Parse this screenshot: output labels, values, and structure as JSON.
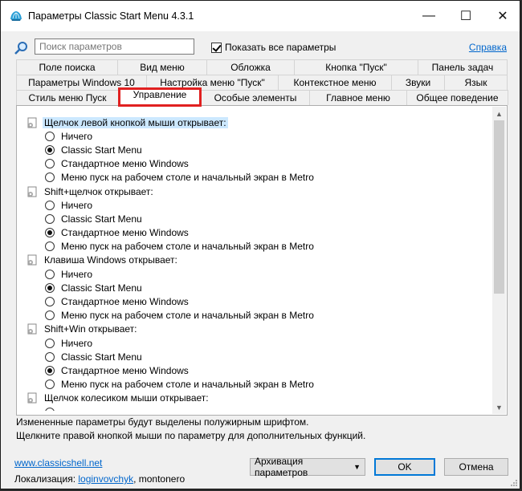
{
  "window": {
    "title": "Параметры Classic Start Menu 4.3.1",
    "minimize": "—",
    "maximize": "☐",
    "close": "✕"
  },
  "toolbar": {
    "search_placeholder": "Поиск параметров",
    "show_all_label": "Показать все параметры",
    "show_all_checked": true,
    "help_link": "Справка"
  },
  "tabs": {
    "row1": [
      "Поле поиска",
      "Вид меню",
      "Обложка",
      "Кнопка \"Пуск\"",
      "Панель задач"
    ],
    "row2": [
      "Параметры Windows 10",
      "Настройка меню \"Пуск\"",
      "Контекстное меню",
      "Звуки",
      "Язык"
    ],
    "row3": [
      "Стиль меню Пуск",
      "Управление",
      "Особые элементы",
      "Главное меню",
      "Общее поведение"
    ],
    "active": "Управление"
  },
  "options": {
    "options_list": {
      "group1": "Щелчок левой кнопкой мыши открывает:",
      "g1_o1": "Ничего",
      "g1_o2": "Classic Start Menu",
      "g1_o3": "Стандартное меню Windows",
      "g1_o4": "Меню пуск на рабочем столе и начальный экран в Metro",
      "group2": "Shift+щелчок открывает:",
      "g2_o1": "Ничего",
      "g2_o2": "Classic Start Menu",
      "g2_o3": "Стандартное меню Windows",
      "g2_o4": "Меню пуск на рабочем столе и начальный экран в Metro",
      "group3": "Клавиша Windows открывает:",
      "g3_o1": "Ничего",
      "g3_o2": "Classic Start Menu",
      "g3_o3": "Стандартное меню Windows",
      "g3_o4": "Меню пуск на рабочем столе и начальный экран в Metro",
      "group4": "Shift+Win открывает:",
      "g4_o1": "Ничего",
      "g4_o2": "Classic Start Menu",
      "g4_o3": "Стандартное меню Windows",
      "g4_o4": "Меню пуск на рабочем столе и начальный экран в Metro",
      "group5": "Щелчок колесиком мыши открывает:"
    },
    "selected": {
      "group1": "Classic Start Menu",
      "group2": "Стандартное меню Windows",
      "group3": "Classic Start Menu",
      "group4": "Стандартное меню Windows"
    }
  },
  "info": {
    "line1": "Измененные параметры будут выделены полужирным шрифтом.",
    "line2": "Щелкните правой кнопкой мыши по параметру для дополнительных функций."
  },
  "footer": {
    "website": "www.classicshell.net",
    "localization_label": "Локализация:",
    "localization_author": "loginvovchyk",
    "localization_rest": ", montonero",
    "archive_button": "Архивация параметров",
    "ok_button": "OK",
    "cancel_button": "Отмена"
  },
  "colors": {
    "active_tab_highlight": "#e02020",
    "link": "#0066cc",
    "selection": "#cce8ff"
  }
}
